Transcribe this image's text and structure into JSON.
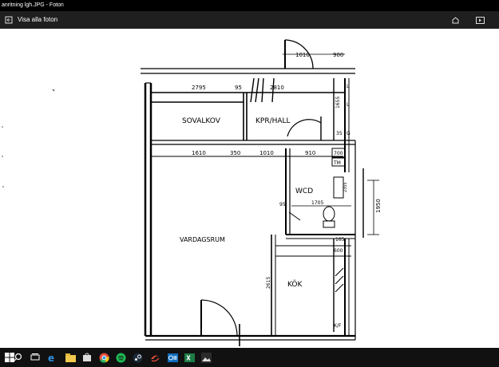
{
  "window": {
    "title": "anritning lgh.JPG - Foton",
    "back_label": "Visa alla foton"
  },
  "plan": {
    "rooms": {
      "sovalkov": "SOVALKOV",
      "kpr_hall": "KPR/HALL",
      "wc": "WC",
      "wcd": "D",
      "vardagsrum": "VARDAGSRUM",
      "kok": "KÖK"
    },
    "dimensions": {
      "d1010_top": "1010",
      "d900": "900",
      "d2795": "2795",
      "d95": "95",
      "d2810": "2810",
      "d1610": "1610",
      "d350": "350",
      "d1010_mid": "1010",
      "d910": "910",
      "d700": "700",
      "d1705": "1705",
      "d1950": "1950",
      "d2615": "2615",
      "d600": "600",
      "d1655": "1655",
      "d35": "35",
      "d2355": "2355",
      "d95b": "95",
      "d165": "165"
    },
    "symbols": {
      "g": "G",
      "l": "L",
      "tm": "TM",
      "kf": "K/F"
    }
  },
  "icons": {
    "back": "back-arrow-icon",
    "toolbar": [
      "edit-icon",
      "slideshow-icon"
    ],
    "taskbar": [
      "windows-start-icon",
      "search-icon",
      "task-view-icon",
      "edge-icon",
      "file-explorer-icon",
      "store-icon",
      "chrome-icon",
      "spotify-icon",
      "steam-icon",
      "opera-icon",
      "outlook-icon",
      "excel-icon",
      "photos-icon"
    ]
  }
}
